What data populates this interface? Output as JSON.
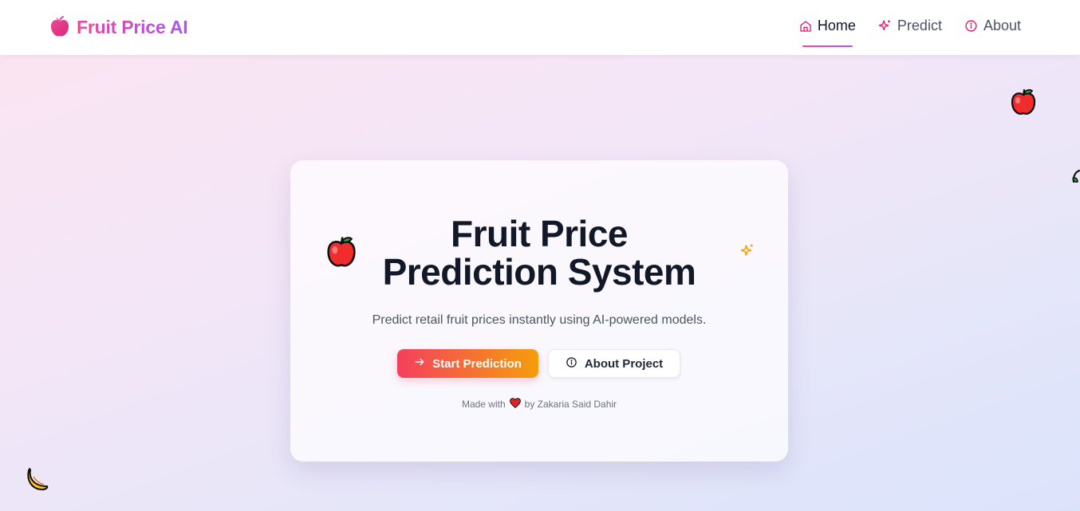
{
  "brand": {
    "name": "Fruit Price AI",
    "icon": "fruit-logo-icon"
  },
  "nav": {
    "items": [
      {
        "label": "Home",
        "icon": "home-icon",
        "active": true
      },
      {
        "label": "Predict",
        "icon": "sparkle-icon",
        "active": false
      },
      {
        "label": "About",
        "icon": "info-icon",
        "active": false
      }
    ]
  },
  "hero": {
    "title_line1": "Fruit Price",
    "title_line2": "Prediction System",
    "subtitle": "Predict retail fruit prices instantly using AI-powered models.",
    "primary_button": "Start Prediction",
    "secondary_button": "About Project",
    "footer_prefix": "Made with",
    "footer_suffix": "by Zakaria Said Dahir"
  },
  "colors": {
    "brand_gradient_start": "#ec4899",
    "brand_gradient_end": "#a855f7",
    "primary_gradient_start": "#f43f5e",
    "primary_gradient_end": "#f59e0b"
  }
}
